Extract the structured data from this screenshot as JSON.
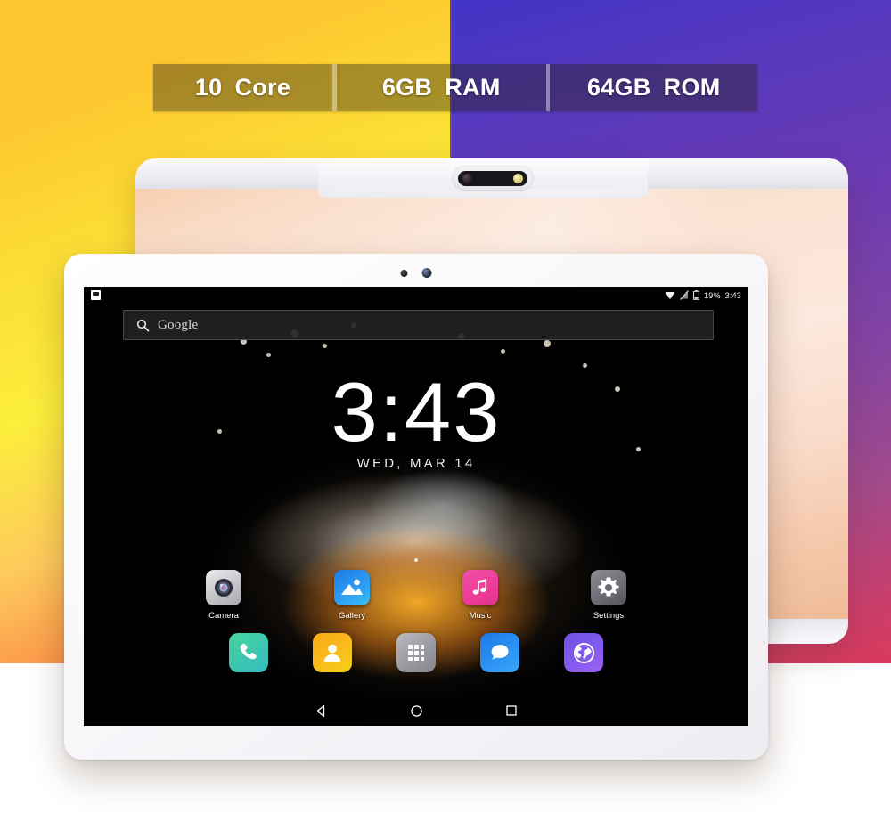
{
  "banner": {
    "cells": [
      {
        "id": "cpu",
        "value": "10",
        "unit": "Core"
      },
      {
        "id": "ram",
        "value": "6GB",
        "unit": "RAM"
      },
      {
        "id": "rom",
        "value": "64GB",
        "unit": "ROM"
      }
    ]
  },
  "colors": {
    "bg_yellow_start": "#FDC52F",
    "bg_yellow_bright": "#FCEE3C",
    "bg_orange_end": "#FB6C3C",
    "bg_blue_start": "#4233C6",
    "bg_purple_mid": "#6C3BB3",
    "bg_crimson_end": "#D93A5C",
    "device_rose_gold": "#FBE2D2",
    "device_white": "#FFFFFF",
    "screen_black": "#000000"
  },
  "device": {
    "rear": {
      "camera_icon": "rear-camera-module",
      "lens_icon": "camera-lens-icon",
      "flash_icon": "camera-flash-icon"
    },
    "front": {
      "sensor_icon": "proximity-sensor-icon",
      "front_camera_icon": "front-camera-icon"
    }
  },
  "screen": {
    "statusbar": {
      "notification_icon": "screenshot-notification-icon",
      "wifi_icon": "wifi-icon",
      "signal_icon": "no-sim-signal-icon",
      "battery_icon": "battery-icon",
      "battery_text": "19%",
      "clock_text": "3:43"
    },
    "search": {
      "icon": "search-icon",
      "label": "Google",
      "placeholder": "Google"
    },
    "clock_widget": {
      "time": "3:43",
      "date": "WED, MAR 14"
    },
    "apps": [
      {
        "label": "Camera",
        "icon": "camera-app-icon"
      },
      {
        "label": "Gallery",
        "icon": "gallery-app-icon"
      },
      {
        "label": "Music",
        "icon": "music-app-icon"
      },
      {
        "label": "Settings",
        "icon": "settings-app-icon"
      }
    ],
    "dock": [
      {
        "label": "Phone",
        "icon": "phone-icon"
      },
      {
        "label": "Contacts",
        "icon": "contacts-icon"
      },
      {
        "label": "App Drawer",
        "icon": "app-drawer-icon"
      },
      {
        "label": "Messages",
        "icon": "messages-icon"
      },
      {
        "label": "Browser",
        "icon": "browser-globe-icon"
      }
    ],
    "navbar": [
      {
        "label": "Back",
        "icon": "back-triangle-icon"
      },
      {
        "label": "Home",
        "icon": "home-circle-icon"
      },
      {
        "label": "Recents",
        "icon": "recents-square-icon"
      }
    ]
  }
}
